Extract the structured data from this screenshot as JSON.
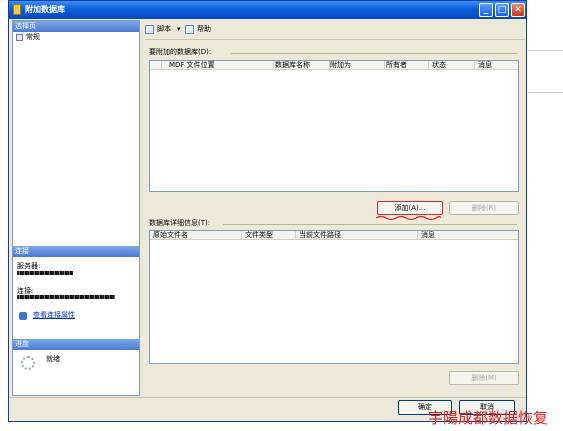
{
  "window": {
    "title": "附加数据库",
    "controls": {
      "minimize": "_",
      "maximize": "□",
      "close": "✕"
    }
  },
  "left": {
    "select_page_header": "选择页",
    "pages": [
      {
        "label": "常规"
      }
    ],
    "connection_header": "连接",
    "server_label": "服务器:",
    "connection_label": "连接:",
    "view_connection_link": "查看连接属性",
    "progress_header": "进度",
    "progress_status": "就绪"
  },
  "toolbar": {
    "script_label": "脚本",
    "script_arrow": "▾",
    "help_label": "帮助"
  },
  "attach": {
    "label": "要附加的数据库(D):",
    "columns": [
      "MDF 文件位置",
      "数据库名称",
      "附加为",
      "所有者",
      "状态",
      "消息"
    ],
    "add_button": "添加(A)...",
    "remove_button": "删除(R)"
  },
  "details": {
    "label": "数据库详细信息(T):",
    "columns": [
      "原始文件名",
      "文件类型",
      "当前文件路径",
      "消息"
    ],
    "remove_button": "删除(M)"
  },
  "footer": {
    "ok_button": "确定",
    "cancel_button": "取消"
  },
  "watermark": "宇陽成都数据恢复",
  "colors": {
    "accent": "#0a5fdc",
    "annotation": "#e02020"
  }
}
